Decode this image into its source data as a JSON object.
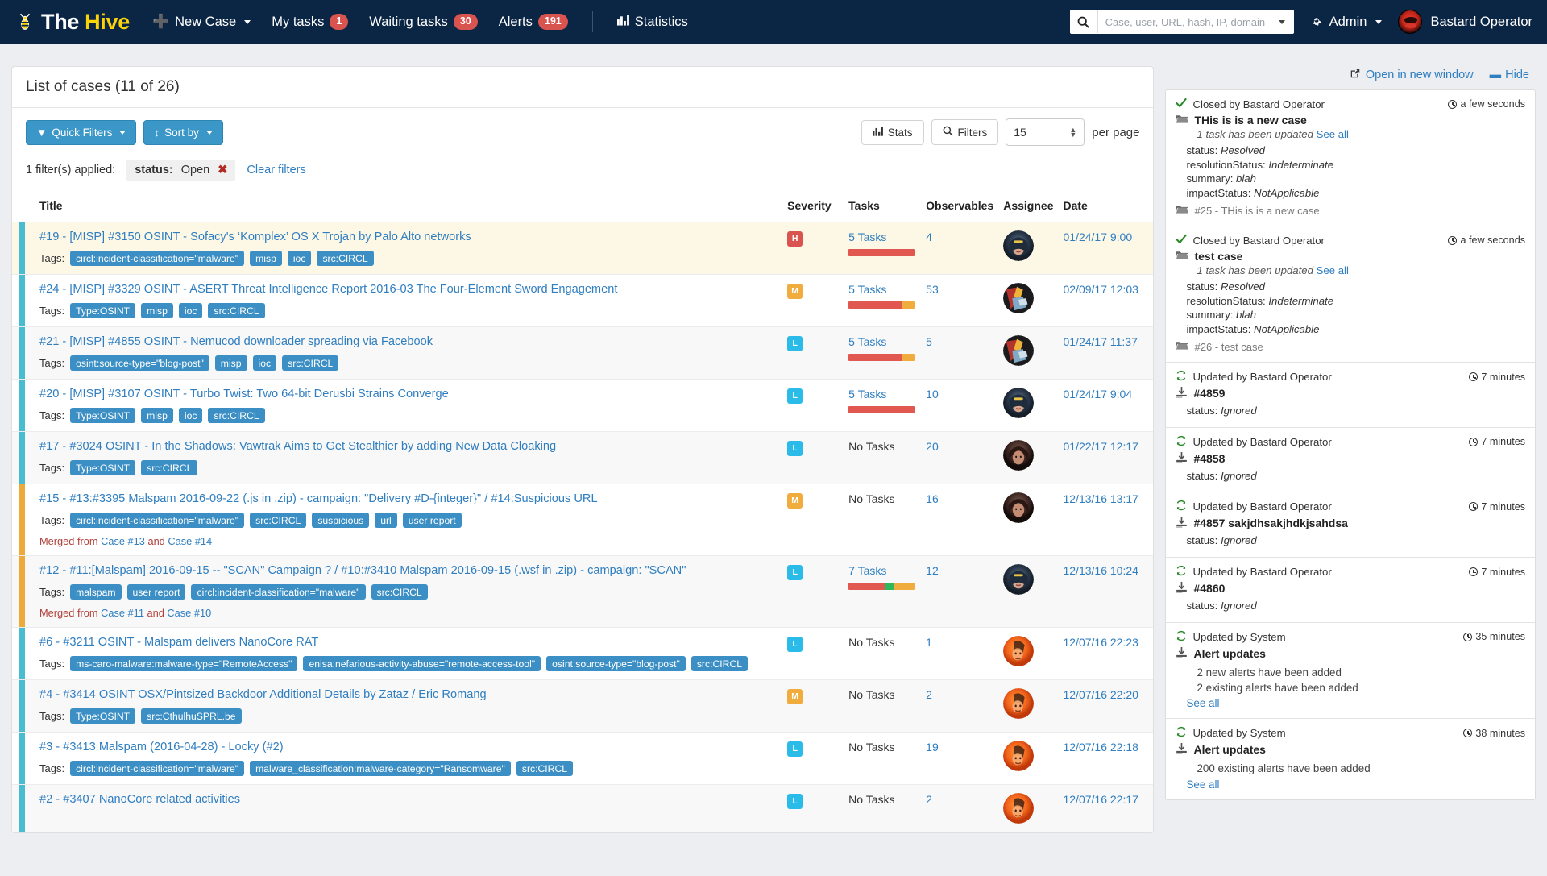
{
  "navbar": {
    "brand": {
      "part1": "The",
      "part2": "Hive"
    },
    "items": [
      {
        "name": "new-case",
        "label": "New Case",
        "icon": "plus-icon",
        "caret": true,
        "badge": null
      },
      {
        "name": "my-tasks",
        "label": "My tasks",
        "icon": null,
        "caret": false,
        "badge": "1"
      },
      {
        "name": "waiting-tasks",
        "label": "Waiting tasks",
        "icon": null,
        "caret": false,
        "badge": "30"
      },
      {
        "name": "alerts",
        "label": "Alerts",
        "icon": null,
        "caret": false,
        "badge": "191"
      },
      {
        "name": "statistics",
        "label": "Statistics",
        "icon": "bar-chart-icon",
        "caret": false,
        "badge": null
      }
    ],
    "search": {
      "placeholder": "Case, user, URL, hash, IP, domain ...",
      "value": "",
      "icon": "search-icon"
    },
    "admin": {
      "label": "Admin",
      "icon": "gear-icon"
    },
    "user": {
      "label": "Bastard Operator",
      "icon": "avatar-icon"
    }
  },
  "colors": {
    "navbar_bg": "#0b2545",
    "brand_yellow": "#fcd307",
    "primary": "#3b97c8",
    "link": "#2f7ec0",
    "severity_high": "#d9534f",
    "severity_medium": "#f0ad3e",
    "severity_low": "#2bbbe8",
    "task_red": "#e0584f",
    "task_orange": "#f0ad3e",
    "task_green": "#2eb85c",
    "flag_teal": "#49bcd0",
    "flag_orange": "#edaa3b",
    "merged_text": "#b0413a"
  },
  "list": {
    "title": "List of cases (11 of 26)",
    "quick_filters_label": "Quick Filters",
    "sort_by_label": "Sort by",
    "stats_label": "Stats",
    "filters_label": "Filters",
    "per_page_value": "15",
    "per_page_label": "per page",
    "filters_applied_text": "1 filter(s) applied:",
    "filter_chip": {
      "key": "status:",
      "value": "Open",
      "remove": "✖"
    },
    "clear_filters_label": "Clear filters",
    "columns": [
      "Title",
      "Severity",
      "Tasks",
      "Observables",
      "Assignee",
      "Date"
    ],
    "rows": [
      {
        "flag": "teal",
        "highlight": "a",
        "title": "#19 - [MISP] #3150 OSINT - Sofacy's ‘Komplex’ OS X Trojan by Palo Alto networks",
        "tags_label": "Tags:",
        "tags": [
          "circl:incident-classification=\"malware\"",
          "misp",
          "ioc",
          "src:CIRCL"
        ],
        "merged": null,
        "severity": "H",
        "tasks": "5 Tasks",
        "bar": [
          {
            "color": "#e0584f",
            "pct": 100
          }
        ],
        "observables": "4",
        "assignee": "wonder-woman-avatar",
        "date": "01/24/17 9:00"
      },
      {
        "flag": "teal",
        "highlight": "b",
        "title": "#24 - [MISP] #3329 OSINT - ASERT Threat Intelligence Report 2016-03 The Four-Element Sword Engagement",
        "tags_label": "Tags:",
        "tags": [
          "Type:OSINT",
          "misp",
          "ioc",
          "src:CIRCL"
        ],
        "merged": null,
        "severity": "M",
        "tasks": "5 Tasks",
        "bar": [
          {
            "color": "#e0584f",
            "pct": 80
          },
          {
            "color": "#f0ad3e",
            "pct": 20
          }
        ],
        "observables": "53",
        "assignee": "transformer-avatar",
        "date": "02/09/17 12:03"
      },
      {
        "flag": "teal",
        "highlight": "c",
        "title": "#21 - [MISP] #4855 OSINT - Nemucod downloader spreading via Facebook",
        "tags_label": "Tags:",
        "tags": [
          "osint:source-type=\"blog-post\"",
          "misp",
          "ioc",
          "src:CIRCL"
        ],
        "merged": null,
        "severity": "L",
        "tasks": "5 Tasks",
        "bar": [
          {
            "color": "#e0584f",
            "pct": 80
          },
          {
            "color": "#f0ad3e",
            "pct": 20
          }
        ],
        "observables": "5",
        "assignee": "transformer-avatar",
        "date": "01/24/17 11:37"
      },
      {
        "flag": "teal",
        "highlight": "b",
        "title": "#20 - [MISP] #3107 OSINT - Turbo Twist: Two 64-bit Derusbi Strains Converge",
        "tags_label": "Tags:",
        "tags": [
          "Type:OSINT",
          "misp",
          "ioc",
          "src:CIRCL"
        ],
        "merged": null,
        "severity": "L",
        "tasks": "5 Tasks",
        "bar": [
          {
            "color": "#e0584f",
            "pct": 100
          }
        ],
        "observables": "10",
        "assignee": "wonder-woman-avatar",
        "date": "01/24/17 9:04"
      },
      {
        "flag": "teal",
        "highlight": "c",
        "title": "#17 - #3024 OSINT - In the Shadows: Vawtrak Aims to Get Stealthier by adding New Data Cloaking",
        "tags_label": "Tags:",
        "tags": [
          "Type:OSINT",
          "src:CIRCL"
        ],
        "merged": null,
        "severity": "L",
        "tasks": "No Tasks",
        "bar": [],
        "observables": "20",
        "assignee": "dark-avatar",
        "date": "01/22/17 12:17"
      },
      {
        "flag": "orange",
        "highlight": "b",
        "title": "#15 - #13:#3395 Malspam 2016-09-22 (.js in .zip) - campaign: \"Delivery #D-{integer}\" / #14:Suspicious URL",
        "tags_label": "Tags:",
        "tags": [
          "circl:incident-classification=\"malware\"",
          "src:CIRCL",
          "suspicious",
          "url",
          "user report"
        ],
        "merged": {
          "prefix": "Merged from ",
          "case1": "Case #13",
          "mid": " and ",
          "case2": "Case #14"
        },
        "severity": "M",
        "tasks": "No Tasks",
        "bar": [],
        "observables": "16",
        "assignee": "dark-avatar",
        "date": "12/13/16 13:17"
      },
      {
        "flag": "orange",
        "highlight": "c",
        "title": "#12 - #11:[Malspam] 2016-09-15 -- \"SCAN\" Campaign ? / #10:#3410 Malspam 2016-09-15 (.wsf in .zip) - campaign: \"SCAN\"",
        "tags_label": "Tags:",
        "tags": [
          "malspam",
          "user report",
          "circl:incident-classification=\"malware\"",
          "src:CIRCL"
        ],
        "merged": {
          "prefix": "Merged from ",
          "case1": "Case #11",
          "mid": " and ",
          "case2": "Case #10"
        },
        "severity": "L",
        "tasks": "7 Tasks",
        "bar": [
          {
            "color": "#e0584f",
            "pct": 55
          },
          {
            "color": "#2eb85c",
            "pct": 13
          },
          {
            "color": "#f0ad3e",
            "pct": 32
          }
        ],
        "observables": "12",
        "assignee": "wonder-woman-avatar",
        "date": "12/13/16 10:24"
      },
      {
        "flag": "teal",
        "highlight": "b",
        "title": "#6 - #3211 OSINT - Malspam delivers NanoCore RAT",
        "tags_label": "Tags:",
        "tags": [
          "ms-caro-malware:malware-type=\"RemoteAccess\"",
          "enisa:nefarious-activity-abuse=\"remote-access-tool\"",
          "osint:source-type=\"blog-post\"",
          "src:CIRCL"
        ],
        "merged": null,
        "severity": "L",
        "tasks": "No Tasks",
        "bar": [],
        "observables": "1",
        "assignee": "orange-avatar",
        "date": "12/07/16 22:23"
      },
      {
        "flag": "teal",
        "highlight": "c",
        "title": "#4 - #3414 OSINT OSX/Pintsized Backdoor Additional Details by Zataz / Eric Romang",
        "tags_label": "Tags:",
        "tags": [
          "Type:OSINT",
          "src:CthulhuSPRL.be"
        ],
        "merged": null,
        "severity": "M",
        "tasks": "No Tasks",
        "bar": [],
        "observables": "2",
        "assignee": "orange-avatar",
        "date": "12/07/16 22:20"
      },
      {
        "flag": "teal",
        "highlight": "b",
        "title": "#3 - #3413 Malspam (2016-04-28) - Locky (#2)",
        "tags_label": "Tags:",
        "tags": [
          "circl:incident-classification=\"malware\"",
          "malware_classification:malware-category=\"Ransomware\"",
          "src:CIRCL"
        ],
        "merged": null,
        "severity": "L",
        "tasks": "No Tasks",
        "bar": [],
        "observables": "19",
        "assignee": "orange-avatar",
        "date": "12/07/16 22:18"
      },
      {
        "flag": "teal",
        "highlight": "c",
        "title": "#2 - #3407 NanoCore related activities",
        "tags_label": "",
        "tags": [],
        "merged": null,
        "severity": "L",
        "tasks": "No Tasks",
        "bar": [],
        "observables": "2",
        "assignee": "orange-avatar",
        "date": "12/07/16 22:17"
      }
    ]
  },
  "stream": {
    "open_new_window_label": "Open in new window",
    "hide_label": "Hide",
    "entries": [
      {
        "icon": "check-icon",
        "actor": "Closed by Bastard Operator",
        "time": "a few seconds",
        "obj_icon": "folder-icon",
        "object": "THis is is a new case",
        "sub": "1 task has been updated",
        "sub_link": "See all",
        "kv": [
          {
            "k": "status:",
            "v": "Resolved"
          },
          {
            "k": "resolutionStatus:",
            "v": "Indeterminate"
          },
          {
            "k": "summary:",
            "v": "blah"
          },
          {
            "k": "impactStatus:",
            "v": "NotApplicable"
          }
        ],
        "footer": "#25 - THis is is a new case",
        "footer_icon": "folder-icon",
        "lines": [],
        "see_all": null
      },
      {
        "icon": "check-icon",
        "actor": "Closed by Bastard Operator",
        "time": "a few seconds",
        "obj_icon": "folder-icon",
        "object": "test case",
        "sub": "1 task has been updated",
        "sub_link": "See all",
        "kv": [
          {
            "k": "status:",
            "v": "Resolved"
          },
          {
            "k": "resolutionStatus:",
            "v": "Indeterminate"
          },
          {
            "k": "summary:",
            "v": "blah"
          },
          {
            "k": "impactStatus:",
            "v": "NotApplicable"
          }
        ],
        "footer": "#26 - test case",
        "footer_icon": "folder-icon",
        "lines": [],
        "see_all": null
      },
      {
        "icon": "refresh-icon",
        "actor": "Updated by Bastard Operator",
        "time": "7 minutes",
        "obj_icon": "import-icon",
        "object": "#4859",
        "sub": null,
        "sub_link": null,
        "kv": [
          {
            "k": "status:",
            "v": "Ignored"
          }
        ],
        "footer": null,
        "footer_icon": null,
        "lines": [],
        "see_all": null
      },
      {
        "icon": "refresh-icon",
        "actor": "Updated by Bastard Operator",
        "time": "7 minutes",
        "obj_icon": "import-icon",
        "object": "#4858",
        "sub": null,
        "sub_link": null,
        "kv": [
          {
            "k": "status:",
            "v": "Ignored"
          }
        ],
        "footer": null,
        "footer_icon": null,
        "lines": [],
        "see_all": null
      },
      {
        "icon": "refresh-icon",
        "actor": "Updated by Bastard Operator",
        "time": "7 minutes",
        "obj_icon": "import-icon",
        "object": "#4857 sakjdhsakjhdkjsahdsa",
        "sub": null,
        "sub_link": null,
        "kv": [
          {
            "k": "status:",
            "v": "Ignored"
          }
        ],
        "footer": null,
        "footer_icon": null,
        "lines": [],
        "see_all": null
      },
      {
        "icon": "refresh-icon",
        "actor": "Updated by Bastard Operator",
        "time": "7 minutes",
        "obj_icon": "import-icon",
        "object": "#4860",
        "sub": null,
        "sub_link": null,
        "kv": [
          {
            "k": "status:",
            "v": "Ignored"
          }
        ],
        "footer": null,
        "footer_icon": null,
        "lines": [],
        "see_all": null
      },
      {
        "icon": "refresh-icon",
        "actor": "Updated by System",
        "time": "35 minutes",
        "obj_icon": "import-icon",
        "object": "Alert updates",
        "sub": null,
        "sub_link": null,
        "kv": [],
        "footer": null,
        "footer_icon": null,
        "lines": [
          "2 new alerts have been added",
          "2 existing alerts have been added"
        ],
        "see_all": "See all"
      },
      {
        "icon": "refresh-icon",
        "actor": "Updated by System",
        "time": "38 minutes",
        "obj_icon": "import-icon",
        "object": "Alert updates",
        "sub": null,
        "sub_link": null,
        "kv": [],
        "footer": null,
        "footer_icon": null,
        "lines": [
          "200 existing alerts have been added"
        ],
        "see_all": "See all"
      }
    ]
  }
}
